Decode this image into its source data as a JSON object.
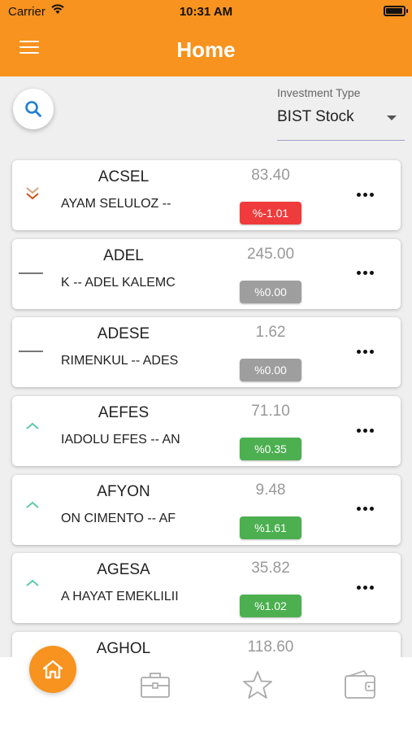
{
  "status_bar": {
    "carrier": "Carrier",
    "time": "10:31 AM"
  },
  "header": {
    "title": "Home"
  },
  "filter": {
    "label": "Investment Type",
    "value": "BIST Stock"
  },
  "colors": {
    "accent": "#f7931e",
    "negative": "#ef3b3b",
    "positive": "#4caf50",
    "neutral": "#9e9e9e",
    "up_arrow": "#5fc9ad",
    "down_arrow": "#c9541b"
  },
  "stocks": [
    {
      "code": "ACSEL",
      "name": "AYAM SELULOZ --",
      "price": "83.40",
      "change": "%-1.01",
      "trend": "down"
    },
    {
      "code": "ADEL",
      "name": "K -- ADEL KALEMC",
      "price": "245.00",
      "change": "%0.00",
      "trend": "flat"
    },
    {
      "code": "ADESE",
      "name": "RIMENKUL -- ADES",
      "price": "1.62",
      "change": "%0.00",
      "trend": "flat"
    },
    {
      "code": "AEFES",
      "name": "IADOLU EFES -- AN",
      "price": "71.10",
      "change": "%0.35",
      "trend": "up"
    },
    {
      "code": "AFYON",
      "name": "ON CIMENTO -- AF",
      "price": "9.48",
      "change": "%1.61",
      "trend": "up"
    },
    {
      "code": "AGESA",
      "name": "A HAYAT EMEKLILII",
      "price": "35.82",
      "change": "%1.02",
      "trend": "up"
    },
    {
      "code": "AGHOL",
      "name": "",
      "price": "118.60",
      "change": "",
      "trend": "up"
    }
  ],
  "bottom_nav": [
    "home-icon",
    "portfolio-icon",
    "star-icon",
    "wallet-icon"
  ]
}
